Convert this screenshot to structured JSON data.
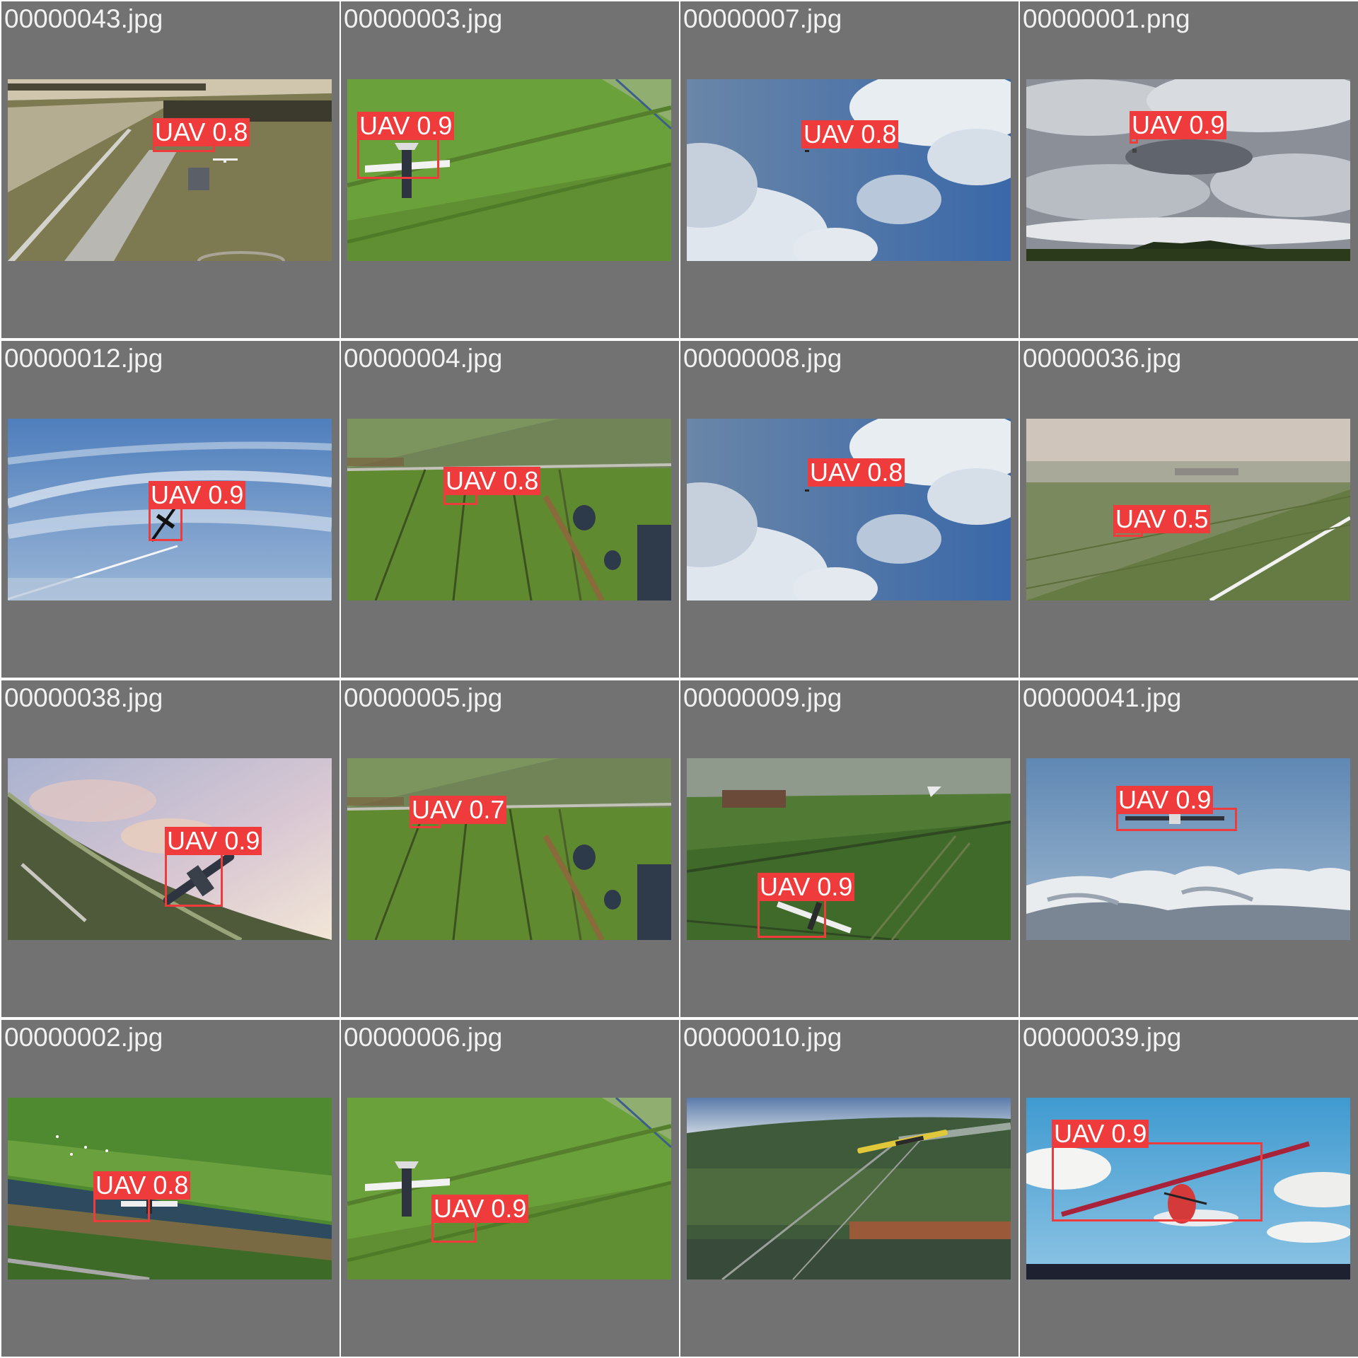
{
  "tiles": [
    {
      "filename": "00000043.jpg",
      "scene": "farmland-runway",
      "detection": {
        "label": "UAV",
        "confidence": "0.8"
      }
    },
    {
      "filename": "00000003.jpg",
      "scene": "green-field-top",
      "detection": {
        "label": "UAV",
        "confidence": "0.9"
      }
    },
    {
      "filename": "00000007.jpg",
      "scene": "blue-sky-clouds",
      "detection": {
        "label": "UAV",
        "confidence": "0.8"
      }
    },
    {
      "filename": "00000001.png",
      "scene": "grey-clouds-treeline",
      "detection": {
        "label": "UAV",
        "confidence": "0.9"
      }
    },
    {
      "filename": "00000012.jpg",
      "scene": "wispy-sky",
      "detection": {
        "label": "UAV",
        "confidence": "0.9"
      }
    },
    {
      "filename": "00000004.jpg",
      "scene": "polder-fields",
      "detection": {
        "label": "UAV",
        "confidence": "0.8"
      }
    },
    {
      "filename": "00000008.jpg",
      "scene": "blue-sky-clouds",
      "detection": {
        "label": "UAV",
        "confidence": "0.8"
      }
    },
    {
      "filename": "00000036.jpg",
      "scene": "hazy-fields",
      "detection": {
        "label": "UAV",
        "confidence": "0.5"
      }
    },
    {
      "filename": "00000038.jpg",
      "scene": "sunset-sky-tilted",
      "detection": {
        "label": "UAV",
        "confidence": "0.9"
      }
    },
    {
      "filename": "00000005.jpg",
      "scene": "polder-fields",
      "detection": {
        "label": "UAV",
        "confidence": "0.7"
      }
    },
    {
      "filename": "00000009.jpg",
      "scene": "aerial-fields-dark",
      "detection": {
        "label": "UAV",
        "confidence": "0.9"
      }
    },
    {
      "filename": "00000041.jpg",
      "scene": "snowy-mountains",
      "detection": {
        "label": "UAV",
        "confidence": "0.9"
      }
    },
    {
      "filename": "00000002.jpg",
      "scene": "fields-canal",
      "detection": {
        "label": "UAV",
        "confidence": "0.8"
      }
    },
    {
      "filename": "00000006.jpg",
      "scene": "green-field-top",
      "detection": {
        "label": "UAV",
        "confidence": "0.9"
      }
    },
    {
      "filename": "00000010.jpg",
      "scene": "aerial-town-horizon",
      "detection": null
    },
    {
      "filename": "00000039.jpg",
      "scene": "blue-sky-red-glider",
      "detection": {
        "label": "UAV",
        "confidence": "0.9"
      }
    }
  ],
  "colors": {
    "tile_background": "#727272",
    "detection_red": "#ef3b3b",
    "filename_text": "#f2f2f2"
  }
}
